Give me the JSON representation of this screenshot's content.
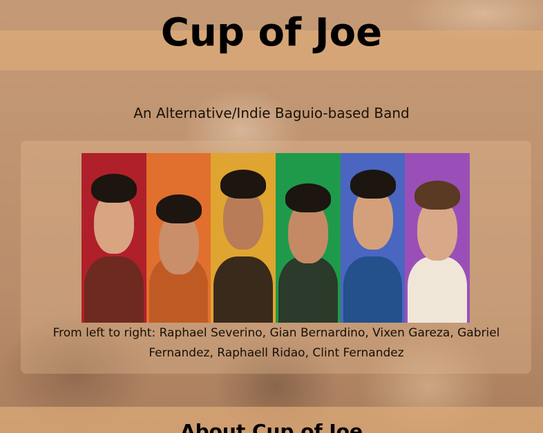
{
  "header": {
    "title": "Cup of Joe",
    "subtitle": "An Alternative/Indie Baguio-based Band"
  },
  "photo": {
    "icon": "band-photo",
    "strip_colors": [
      "#b0202a",
      "#e1702e",
      "#e0a530",
      "#1f9a4a",
      "#4a66c0",
      "#9a4fb8"
    ],
    "caption": "From left to right: Raphael Severino, Gian Bernardino, Vixen Gareza, Gabriel Fernandez, Raphaell Ridao, Clint Fernandez"
  },
  "about": {
    "heading": "About Cup of Joe"
  }
}
